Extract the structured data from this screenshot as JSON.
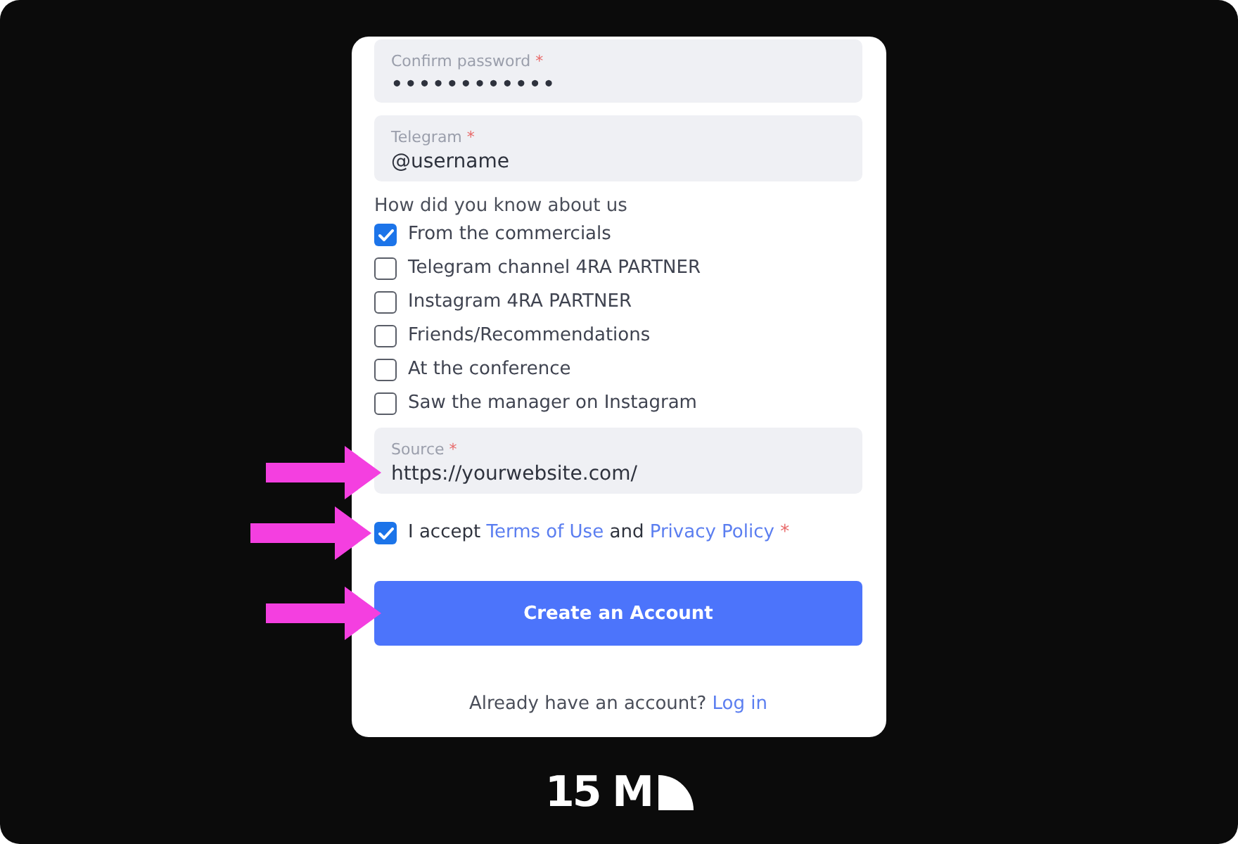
{
  "form": {
    "fields": [
      {
        "label": "Confirm password",
        "required_mark": "*",
        "value": "••••••••••••",
        "kind": "password"
      },
      {
        "label": "Telegram",
        "required_mark": "*",
        "value": "@username",
        "kind": "text"
      }
    ],
    "referral": {
      "question": "How did you know about us",
      "options": [
        {
          "label": "From the commercials",
          "checked": true
        },
        {
          "label": "Telegram channel 4RA PARTNER",
          "checked": false
        },
        {
          "label": "Instagram 4RA PARTNER",
          "checked": false
        },
        {
          "label": "Friends/Recommendations",
          "checked": false
        },
        {
          "label": "At the conference",
          "checked": false
        },
        {
          "label": "Saw the manager on Instagram",
          "checked": false
        }
      ]
    },
    "source_field": {
      "label": "Source",
      "required_mark": "*",
      "value": "https://yourwebsite.com/",
      "kind": "text",
      "arrow": true
    },
    "consent": {
      "checked": true,
      "text": "I accept",
      "terms_link": "Terms of Use",
      "conjunction": "and",
      "privacy_link": "Privacy Policy",
      "required_mark": "*",
      "arrow": true
    },
    "submit_button": {
      "label": "Create an Account",
      "arrow": true
    },
    "login_prompt": {
      "text": "Already have an account?",
      "link": "Log in"
    }
  },
  "brand_logo": {
    "text": "15 M"
  }
}
